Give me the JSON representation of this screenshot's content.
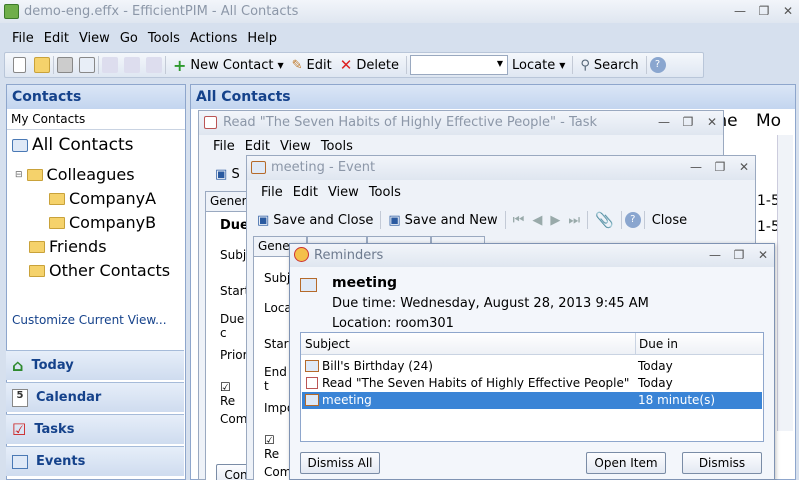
{
  "main": {
    "title": "demo-eng.effx - EfficientPIM - All Contacts",
    "menu": [
      "File",
      "Edit",
      "View",
      "Go",
      "Tools",
      "Actions",
      "Help"
    ],
    "toolbar": {
      "new_contact": "New Contact",
      "edit": "Edit",
      "delete": "Delete",
      "locate": "Locate",
      "search": "Search"
    }
  },
  "sidebar": {
    "header": "Contacts",
    "subheader": "My Contacts",
    "tree": {
      "all_contacts": "All Contacts",
      "colleagues": "Colleagues",
      "company_a": "CompanyA",
      "company_b": "CompanyB",
      "friends": "Friends",
      "other_contacts": "Other Contacts"
    },
    "customize": "Customize Current View...",
    "nav": [
      "Today",
      "Calendar",
      "Tasks",
      "Events"
    ]
  },
  "content": {
    "header": "All Contacts",
    "col_partial_1": "one",
    "col_partial_2": "Mo",
    "num_1": "1-5",
    "num_2": "1-5"
  },
  "task_window": {
    "title": "Read \"The Seven Habits of Highly Effective People\" - Task",
    "menu": [
      "File",
      "Edit",
      "View",
      "Tools"
    ],
    "save_partial": "S",
    "tab_partial": "Genera",
    "fields": [
      "Due",
      "Subje",
      "Start",
      "Due c",
      "Priorit",
      "Re",
      "Comm",
      "Con"
    ]
  },
  "event_window": {
    "title": "meeting - Event",
    "menu": [
      "File",
      "Edit",
      "View",
      "Tools"
    ],
    "save_close": "Save and Close",
    "save_new": "Save and New",
    "close": "Close",
    "tab_partial": "Genera",
    "fields": [
      "Subje",
      "Loca",
      "Start",
      "End t",
      "Impor",
      "Re",
      "Comm"
    ]
  },
  "reminders": {
    "title": "Reminders",
    "subject": "meeting",
    "due_time": "Due time: Wednesday, August 28, 2013 9:45 AM",
    "location": "Location: room301",
    "col_subject": "Subject",
    "col_due": "Due in",
    "rows": [
      {
        "subject": "Bill's Birthday (24)",
        "due": "Today"
      },
      {
        "subject": "Read \"The Seven Habits of Highly Effective People\"",
        "due": "Today"
      },
      {
        "subject": "meeting",
        "due": "18 minute(s)"
      }
    ],
    "dismiss_all": "Dismiss All",
    "open_item": "Open Item",
    "dismiss": "Dismiss"
  }
}
